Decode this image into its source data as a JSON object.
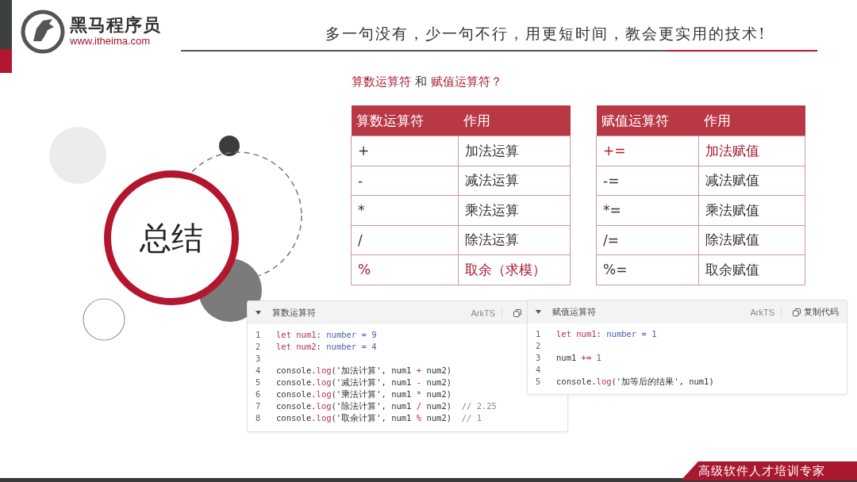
{
  "header": {
    "brand": "黑马程序员",
    "url": "www.itheima.com",
    "slogan": "多一句没有，少一句不行，用更短时间，教会更实用的技术!"
  },
  "summary": {
    "title": "总结"
  },
  "question": [
    {
      "text": "算数运算符",
      "highlighted": true
    },
    {
      "text": " 和 ",
      "highlighted": false
    },
    {
      "text": "赋值运算符？",
      "highlighted": true
    }
  ],
  "tables": [
    {
      "columns": [
        "算数运算符",
        "作用"
      ],
      "rows": [
        {
          "cells": [
            "+",
            "加法运算"
          ],
          "highlighted": false
        },
        {
          "cells": [
            "-",
            "减法运算"
          ],
          "highlighted": false
        },
        {
          "cells": [
            "*",
            "乘法运算"
          ],
          "highlighted": false
        },
        {
          "cells": [
            "/",
            "除法运算"
          ],
          "highlighted": false
        },
        {
          "cells": [
            "%",
            "取余（求模）"
          ],
          "highlighted": true
        }
      ]
    },
    {
      "columns": [
        "赋值运算符",
        "作用"
      ],
      "rows": [
        {
          "cells": [
            "+=",
            "加法赋值"
          ],
          "highlighted": true
        },
        {
          "cells": [
            "-=",
            "减法赋值"
          ],
          "highlighted": false
        },
        {
          "cells": [
            "*=",
            "乘法赋值"
          ],
          "highlighted": false
        },
        {
          "cells": [
            "/=",
            "除法赋值"
          ],
          "highlighted": false
        },
        {
          "cells": [
            "%=",
            "取余赋值"
          ],
          "highlighted": false
        }
      ]
    }
  ],
  "code_panels": [
    {
      "title": "算数运算符",
      "language": "ArkTS",
      "lines": [
        {
          "number": "1",
          "tokens": [
            {
              "kind": "keyword",
              "text": "let num1"
            },
            {
              "kind": "plain",
              "text": ": "
            },
            {
              "kind": "type",
              "text": "number = 9"
            }
          ]
        },
        {
          "number": "2",
          "tokens": [
            {
              "kind": "keyword",
              "text": "let num2"
            },
            {
              "kind": "plain",
              "text": ": "
            },
            {
              "kind": "type",
              "text": "number = 4"
            }
          ]
        },
        {
          "number": "3"
        },
        {
          "number": "4",
          "tokens": [
            {
              "kind": "plain",
              "text": "console."
            },
            {
              "kind": "function",
              "text": "log"
            },
            {
              "kind": "plain",
              "text": "('加法计算', num1 "
            },
            {
              "kind": "operator",
              "text": "+"
            },
            {
              "kind": "plain",
              "text": " num2)"
            }
          ]
        },
        {
          "number": "5",
          "tokens": [
            {
              "kind": "plain",
              "text": "console."
            },
            {
              "kind": "function",
              "text": "log"
            },
            {
              "kind": "plain",
              "text": "('减法计算', num1 "
            },
            {
              "kind": "operator",
              "text": "-"
            },
            {
              "kind": "plain",
              "text": " num2)"
            }
          ]
        },
        {
          "number": "6",
          "tokens": [
            {
              "kind": "plain",
              "text": "console."
            },
            {
              "kind": "function",
              "text": "log"
            },
            {
              "kind": "plain",
              "text": "('乘法计算', num1 "
            },
            {
              "kind": "operator",
              "text": "*"
            },
            {
              "kind": "plain",
              "text": " num2)"
            }
          ]
        },
        {
          "number": "7",
          "tokens": [
            {
              "kind": "plain",
              "text": "console."
            },
            {
              "kind": "function",
              "text": "log"
            },
            {
              "kind": "plain",
              "text": "('除法计算', num1 "
            },
            {
              "kind": "operator",
              "text": "/"
            },
            {
              "kind": "plain",
              "text": " num2)  "
            },
            {
              "kind": "comment",
              "text": "// 2.25"
            }
          ]
        },
        {
          "number": "8",
          "tokens": [
            {
              "kind": "plain",
              "text": "console."
            },
            {
              "kind": "function",
              "text": "log"
            },
            {
              "kind": "plain",
              "text": "('取余计算', num1 "
            },
            {
              "kind": "operator",
              "text": "%"
            },
            {
              "kind": "plain",
              "text": " num2)  "
            },
            {
              "kind": "comment",
              "text": "// 1"
            }
          ]
        }
      ]
    },
    {
      "title": "赋值运算符",
      "language": "ArkTS",
      "copy_label": "复制代码",
      "lines": [
        {
          "number": "1",
          "tokens": [
            {
              "kind": "keyword",
              "text": "let num1"
            },
            {
              "kind": "plain",
              "text": ": "
            },
            {
              "kind": "type",
              "text": "number = 1"
            }
          ]
        },
        {
          "number": "2"
        },
        {
          "number": "3",
          "tokens": [
            {
              "kind": "plain",
              "text": "num1 "
            },
            {
              "kind": "operator",
              "text": "+="
            },
            {
              "kind": "type",
              "text": " 1"
            }
          ]
        },
        {
          "number": "4"
        },
        {
          "number": "5",
          "tokens": [
            {
              "kind": "plain",
              "text": "console."
            },
            {
              "kind": "function",
              "text": "log"
            },
            {
              "kind": "plain",
              "text": "('加等后的结果', num1)"
            }
          ]
        }
      ]
    }
  ],
  "footer": {
    "tagline": "高级软件人才培训专家"
  }
}
